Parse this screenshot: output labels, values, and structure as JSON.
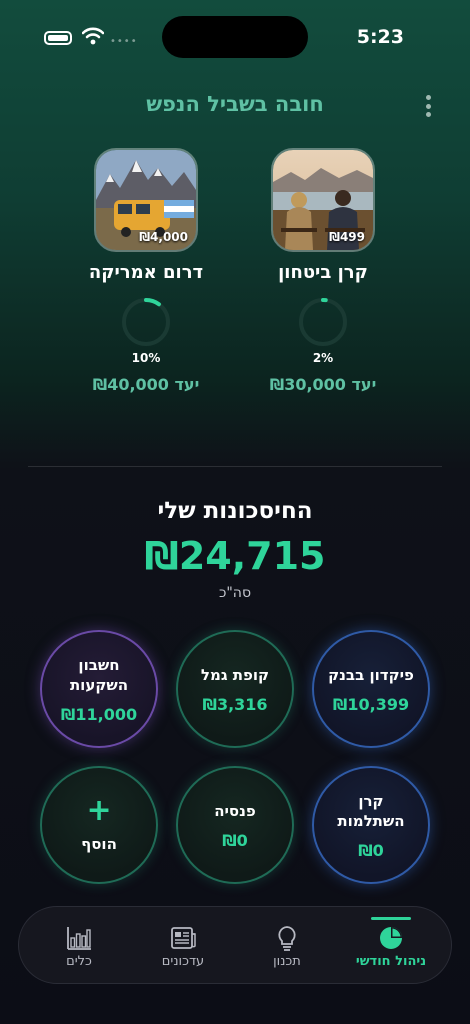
{
  "status_bar": {
    "time": "5:23"
  },
  "header": {
    "title": "חובה בשביל הנפש"
  },
  "goals": [
    {
      "name": "קרן ביטחון",
      "amount": "₪499",
      "percent": "2%",
      "progress": 0.02,
      "target": "יעד ₪30,000"
    },
    {
      "name": "דרום אמריקה",
      "amount": "₪4,000",
      "percent": "10%",
      "progress": 0.1,
      "target": "יעד ₪40,000"
    }
  ],
  "savings": {
    "title": "החיסכונות שלי",
    "total": "₪24,715",
    "total_label": "סה\"כ",
    "accounts": [
      {
        "name": "פיקדון בבנק",
        "value": "₪10,399",
        "color": "#2f5aa6"
      },
      {
        "name": "קופת גמל",
        "value": "₪3,316",
        "color": "#1f6b56"
      },
      {
        "name": "חשבון השקעות",
        "value": "₪11,000",
        "color": "#6a4aa6"
      },
      {
        "name": "קרן השתלמות",
        "value": "₪0",
        "color": "#2f5aa6"
      },
      {
        "name": "פנסיה",
        "value": "₪0",
        "color": "#1f6b56"
      }
    ],
    "add_label": "הוסף",
    "add_icon": "+"
  },
  "tabbar": {
    "items": [
      {
        "label": "ניהול חודשי",
        "icon": "pie-chart-icon",
        "active": true
      },
      {
        "label": "תכנון",
        "icon": "lightbulb-icon",
        "active": false
      },
      {
        "label": "עדכונים",
        "icon": "newspaper-icon",
        "active": false
      },
      {
        "label": "כלים",
        "icon": "bar-chart-icon",
        "active": false
      }
    ]
  },
  "colors": {
    "accent": "#2fd49a",
    "title": "#5fc1a4"
  }
}
